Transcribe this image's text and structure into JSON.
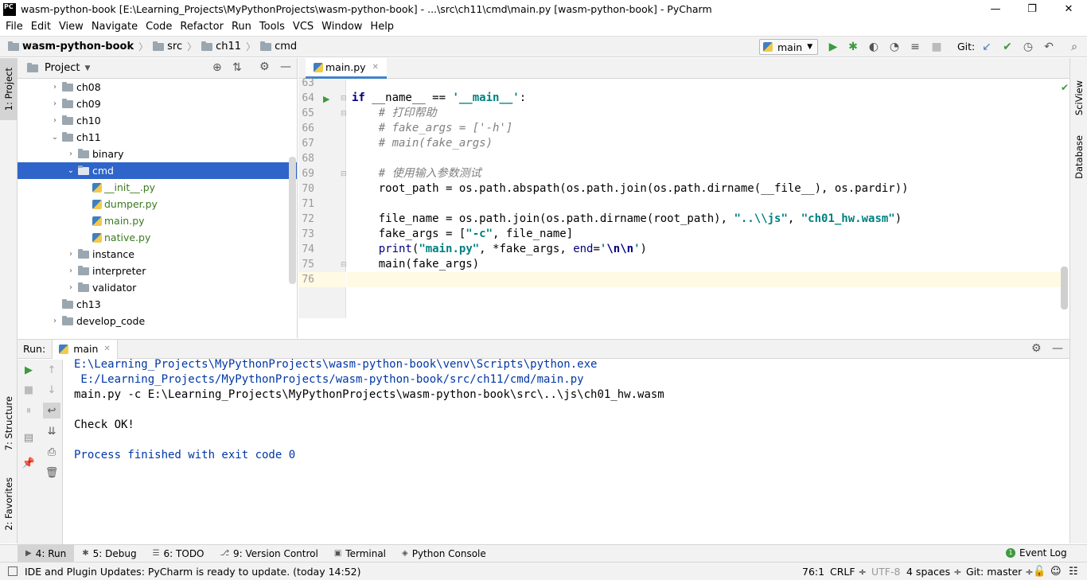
{
  "window": {
    "title": "wasm-python-book [E:\\Learning_Projects\\MyPythonProjects\\wasm-python-book] - ...\\src\\ch11\\cmd\\main.py [wasm-python-book] - PyCharm",
    "app_icon_label": "PC",
    "minimize": "—",
    "restore": "❐",
    "close": "✕"
  },
  "menu": [
    "File",
    "Edit",
    "View",
    "Navigate",
    "Code",
    "Refactor",
    "Run",
    "Tools",
    "VCS",
    "Window",
    "Help"
  ],
  "breadcrumb": [
    "wasm-python-book",
    "src",
    "ch11",
    "cmd"
  ],
  "toolbar": {
    "run_config": "main",
    "git_label": "Git:"
  },
  "left_strip": {
    "project": "1: Project",
    "structure": "7: Structure",
    "favorites": "2: Favorites"
  },
  "right_strip": {
    "sciview": "SciView",
    "database": "Database"
  },
  "project": {
    "header": "Project",
    "tree": [
      {
        "label": "ch08",
        "indent": 0,
        "type": "folder",
        "arrow": "›"
      },
      {
        "label": "ch09",
        "indent": 0,
        "type": "folder",
        "arrow": "›"
      },
      {
        "label": "ch10",
        "indent": 0,
        "type": "folder",
        "arrow": "›"
      },
      {
        "label": "ch11",
        "indent": 0,
        "type": "folder",
        "arrow": "⌄"
      },
      {
        "label": "binary",
        "indent": 1,
        "type": "folder",
        "arrow": "›"
      },
      {
        "label": "cmd",
        "indent": 1,
        "type": "folder",
        "arrow": "⌄",
        "selected": true
      },
      {
        "label": "__init__.py",
        "indent": 2,
        "type": "py",
        "arrow": ""
      },
      {
        "label": "dumper.py",
        "indent": 2,
        "type": "py",
        "arrow": ""
      },
      {
        "label": "main.py",
        "indent": 2,
        "type": "py",
        "arrow": ""
      },
      {
        "label": "native.py",
        "indent": 2,
        "type": "py",
        "arrow": ""
      },
      {
        "label": "instance",
        "indent": 1,
        "type": "folder",
        "arrow": "›"
      },
      {
        "label": "interpreter",
        "indent": 1,
        "type": "folder",
        "arrow": "›"
      },
      {
        "label": "validator",
        "indent": 1,
        "type": "folder",
        "arrow": "›"
      },
      {
        "label": "ch13",
        "indent": 0,
        "type": "folder",
        "arrow": ""
      },
      {
        "label": "develop_code",
        "indent": 0,
        "type": "folder",
        "arrow": "›"
      }
    ]
  },
  "editor": {
    "tab": "main.py",
    "lines": [
      {
        "n": "63",
        "html": ""
      },
      {
        "n": "64",
        "html": "<span class=\"kw\">if</span> __name__ == <span class=\"st\">'__main__'</span>:"
      },
      {
        "n": "65",
        "html": "    <span class=\"cm\"># 打印帮助</span>"
      },
      {
        "n": "66",
        "html": "    <span class=\"cm\"># fake_args = ['-h']</span>"
      },
      {
        "n": "67",
        "html": "    <span class=\"cm\"># main(fake_args)</span>"
      },
      {
        "n": "68",
        "html": ""
      },
      {
        "n": "69",
        "html": "    <span class=\"cm\"># 使用输入参数测试</span>"
      },
      {
        "n": "70",
        "html": "    root_path = os.path.abspath(os.path.join(os.path.dirname(__file__), os.pardir))"
      },
      {
        "n": "71",
        "html": ""
      },
      {
        "n": "72",
        "html": "    file_name = os.path.join(os.path.dirname(root_path), <span class=\"st\">\"..\\\\js\"</span>, <span class=\"st\">\"ch01_hw.wasm\"</span>)"
      },
      {
        "n": "73",
        "html": "    fake_args = [<span class=\"st\">\"-c\"</span>, file_name]"
      },
      {
        "n": "74",
        "html": "    <span class=\"bi\">print</span>(<span class=\"st\">\"main.py\"</span>, *fake_args, <span class=\"bi\">end</span>=<span class=\"st\">'<span class=\"esc\">\\n\\n</span>'</span>)"
      },
      {
        "n": "75",
        "html": "    main(fake_args)"
      },
      {
        "n": "76",
        "html": ""
      }
    ]
  },
  "run": {
    "label": "Run:",
    "tab": "main",
    "output": [
      {
        "text": "E:\\Learning_Projects\\MyPythonProjects\\wasm-python-book\\venv\\Scripts\\python.exe",
        "color": "#0037a6"
      },
      {
        "text": " E:/Learning_Projects/MyPythonProjects/wasm-python-book/src/ch11/cmd/main.py",
        "color": "#0037a6"
      },
      {
        "text": "main.py -c E:\\Learning_Projects\\MyPythonProjects\\wasm-python-book\\src\\..\\js\\ch01_hw.wasm",
        "color": "#000000"
      },
      {
        "text": "",
        "color": "#000000"
      },
      {
        "text": "Check OK!",
        "color": "#000000"
      },
      {
        "text": "",
        "color": "#000000"
      },
      {
        "text": "Process finished with exit code 0",
        "color": "#0037a6"
      }
    ]
  },
  "tool_windows": [
    {
      "label": "4: Run",
      "icon": "▶",
      "active": true
    },
    {
      "label": "5: Debug",
      "icon": "✱",
      "active": false
    },
    {
      "label": "6: TODO",
      "icon": "☰",
      "active": false
    },
    {
      "label": "9: Version Control",
      "icon": "⎇",
      "active": false
    },
    {
      "label": "Terminal",
      "icon": "▣",
      "active": false
    },
    {
      "label": "Python Console",
      "icon": "◈",
      "active": false
    }
  ],
  "event_log": "Event Log",
  "status": {
    "message": "IDE and Plugin Updates: PyCharm is ready to update. (today 14:52)",
    "position": "76:1",
    "line_sep": "CRLF ÷",
    "encoding": "UTF-8",
    "indent": "4 spaces ÷",
    "git": "Git: master ÷"
  },
  "colors": {
    "selection": "#2f65ca",
    "accent": "#4083c9",
    "run_green": "#3d9a3d"
  }
}
